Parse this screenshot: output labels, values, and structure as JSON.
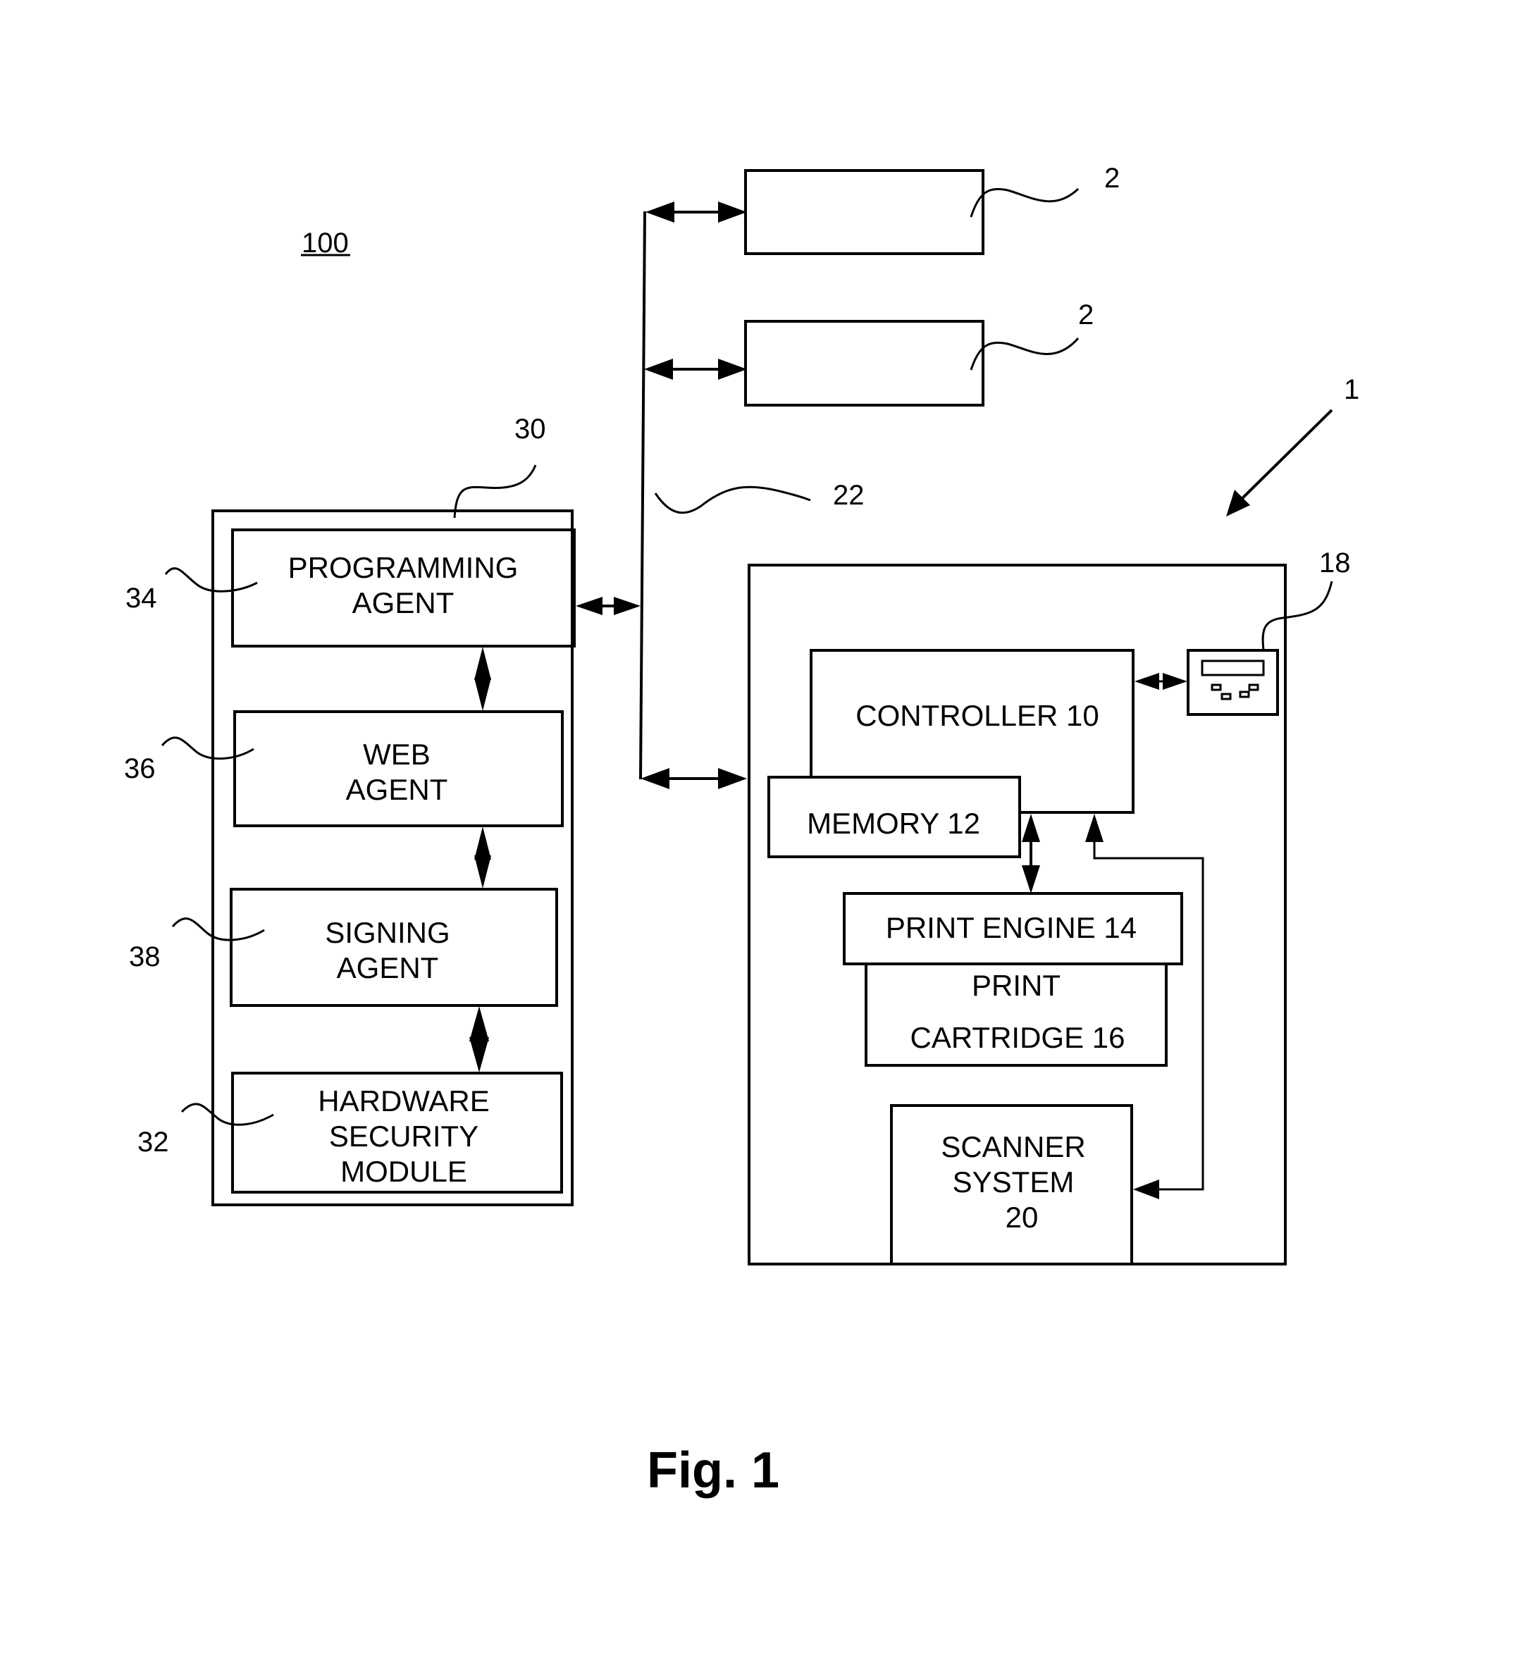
{
  "figure": {
    "system_ref": "100",
    "caption": "Fig. 1"
  },
  "server": {
    "ref": "30",
    "modules": [
      {
        "id": "programming-agent",
        "lines": [
          "PROGRAMMING",
          "AGENT"
        ],
        "ref": "34"
      },
      {
        "id": "web-agent",
        "lines": [
          "WEB",
          "AGENT"
        ],
        "ref": "36"
      },
      {
        "id": "signing-agent",
        "lines": [
          "SIGNING",
          "AGENT"
        ],
        "ref": "38"
      },
      {
        "id": "hardware-security-module",
        "lines": [
          "HARDWARE",
          "SECURITY",
          "MODULE"
        ],
        "ref": "32"
      }
    ]
  },
  "network": {
    "ref": "22"
  },
  "other_devices": [
    {
      "ref": "2"
    },
    {
      "ref": "2"
    }
  ],
  "device": {
    "ref": "1",
    "controller": "CONTROLLER 10",
    "memory": "MEMORY 12",
    "print_engine": "PRINT ENGINE 14",
    "cartridge_lines": [
      "PRINT",
      "CARTRIDGE 16"
    ],
    "scanner_lines": [
      "SCANNER",
      "SYSTEM",
      "20"
    ],
    "panel_ref": "18"
  }
}
